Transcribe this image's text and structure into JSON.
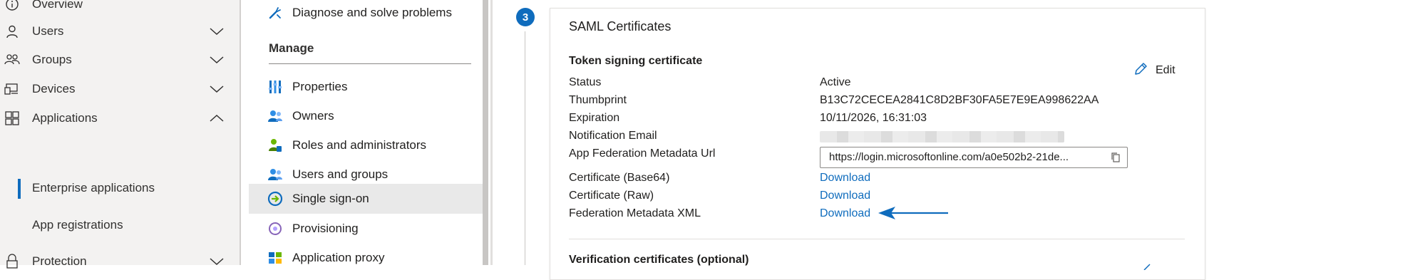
{
  "left_nav": {
    "items": [
      {
        "label": "Overview",
        "icon": "info-icon"
      },
      {
        "label": "Users",
        "icon": "user-icon",
        "chevron": "down"
      },
      {
        "label": "Groups",
        "icon": "group-icon",
        "chevron": "down"
      },
      {
        "label": "Devices",
        "icon": "devices-icon",
        "chevron": "down"
      },
      {
        "label": "Applications",
        "icon": "applications-icon",
        "chevron": "up"
      },
      {
        "label": "Protection",
        "icon": "lock-icon",
        "chevron": "down"
      }
    ],
    "sub_items": [
      {
        "label": "Enterprise applications",
        "selected": true
      },
      {
        "label": "App registrations",
        "selected": false
      }
    ]
  },
  "mid_menu": {
    "top_item": "Diagnose and solve problems",
    "section_header": "Manage",
    "items": [
      {
        "label": "Properties",
        "icon": "properties-icon"
      },
      {
        "label": "Owners",
        "icon": "owners-icon"
      },
      {
        "label": "Roles and administrators",
        "icon": "roles-icon"
      },
      {
        "label": "Users and groups",
        "icon": "users-groups-icon"
      },
      {
        "label": "Single sign-on",
        "icon": "sso-icon",
        "active": true
      },
      {
        "label": "Provisioning",
        "icon": "provisioning-icon"
      },
      {
        "label": "Application proxy",
        "icon": "app-proxy-icon"
      }
    ]
  },
  "main": {
    "step_number": "3",
    "card_title": "SAML Certificates",
    "section_title": "Token signing certificate",
    "edit_label": "Edit",
    "fields": {
      "status_label": "Status",
      "status_value": "Active",
      "thumbprint_label": "Thumbprint",
      "thumbprint_value": "B13C72CECEA2841C8D2BF30FA5E7E9EA998622AA",
      "expiration_label": "Expiration",
      "expiration_value": "10/11/2026, 16:31:03",
      "notification_label": "Notification Email",
      "metadata_url_label": "App Federation Metadata Url",
      "metadata_url_value": "https://login.microsoftonline.com/a0e502b2-21de...",
      "cert_base64_label": "Certificate (Base64)",
      "cert_raw_label": "Certificate (Raw)",
      "fed_xml_label": "Federation Metadata XML",
      "download_label": "Download"
    },
    "next_section_title": "Verification certificates (optional)"
  },
  "colors": {
    "accent": "#0f6cbd",
    "nav_background": "#f3f2f1",
    "active_menu_background": "#e9e9e9"
  }
}
